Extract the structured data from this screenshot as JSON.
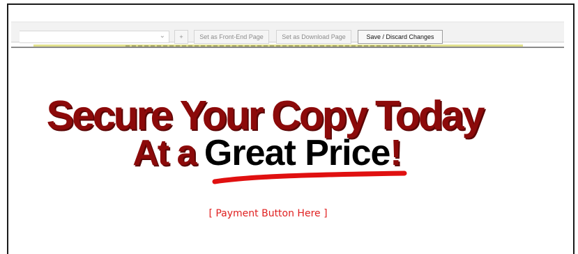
{
  "toolbar": {
    "select_value": "",
    "select_arrow": "⌄",
    "add_label": "+",
    "front_end_label": "Set as Front-End Page",
    "download_label": "Set as Download Page",
    "save_label": "Save / Discard Changes"
  },
  "content": {
    "headline_line1": "Secure Your Copy Today",
    "headline_line2_prefix": "At a ",
    "headline_line2_emphasis": "Great Price",
    "headline_line2_suffix": "!",
    "payment_placeholder": "[ Payment Button Here ]"
  },
  "colors": {
    "headline_red": "#8c0a0a",
    "emphasis_black": "#000000",
    "swoosh_red": "#e01010",
    "payment_red": "#e02020",
    "toolbar_bg": "#f2f2f2"
  },
  "icons": {
    "select_arrow": "chevron-down-icon",
    "underline": "red-swoosh-underline"
  }
}
